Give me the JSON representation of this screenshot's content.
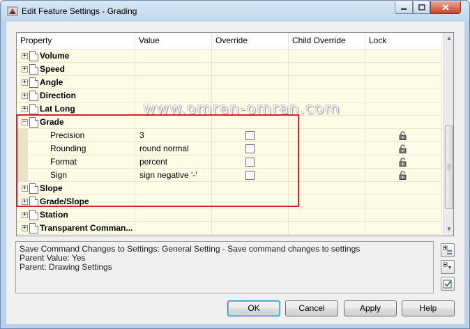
{
  "window": {
    "title": "Edit Feature Settings - Grading",
    "app_icon": "civil3d-app-icon",
    "controls": {
      "minimize": "minimize-icon",
      "maximize": "maximize-icon",
      "close": "close-icon"
    }
  },
  "grid": {
    "columns": [
      "Property",
      "Value",
      "Override",
      "Child Override",
      "Lock"
    ],
    "rows": [
      {
        "type": "category",
        "expander": "+",
        "label": "Volume"
      },
      {
        "type": "category",
        "expander": "+",
        "label": "Speed"
      },
      {
        "type": "category",
        "expander": "+",
        "label": "Angle"
      },
      {
        "type": "category",
        "expander": "+",
        "label": "Direction"
      },
      {
        "type": "category",
        "expander": "+",
        "label": "Lat Long"
      },
      {
        "type": "category",
        "expander": "−",
        "label": "Grade"
      },
      {
        "type": "property",
        "label": "Precision",
        "value": "3",
        "override": false,
        "locked": false
      },
      {
        "type": "property",
        "label": "Rounding",
        "value": "round normal",
        "override": false,
        "locked": false
      },
      {
        "type": "property",
        "label": "Format",
        "value": "percent",
        "override": false,
        "locked": false
      },
      {
        "type": "property",
        "label": "Sign",
        "value": "sign negative '-'",
        "override": false,
        "locked": false
      },
      {
        "type": "category",
        "expander": "+",
        "label": "Slope"
      },
      {
        "type": "category",
        "expander": "+",
        "label": "Grade/Slope"
      },
      {
        "type": "category",
        "expander": "+",
        "label": "Station"
      },
      {
        "type": "category",
        "expander": "+",
        "label": "Transparent Comman..."
      }
    ]
  },
  "watermark": "www.omran-omran.com",
  "description": {
    "lines": [
      "Save Command Changes to Settings: General Setting - Save command changes to settings",
      "Parent Value: Yes",
      "Parent: Drawing Settings"
    ]
  },
  "side_buttons": [
    "expand-all-icon",
    "collapse-all-icon",
    "check-settings-icon"
  ],
  "buttons": {
    "ok": "OK",
    "cancel": "Cancel",
    "apply": "Apply",
    "help": "Help"
  },
  "colors": {
    "row_background": "#fbfbe6",
    "highlight": "#e02020",
    "title_bar": "#bfd5ec"
  }
}
